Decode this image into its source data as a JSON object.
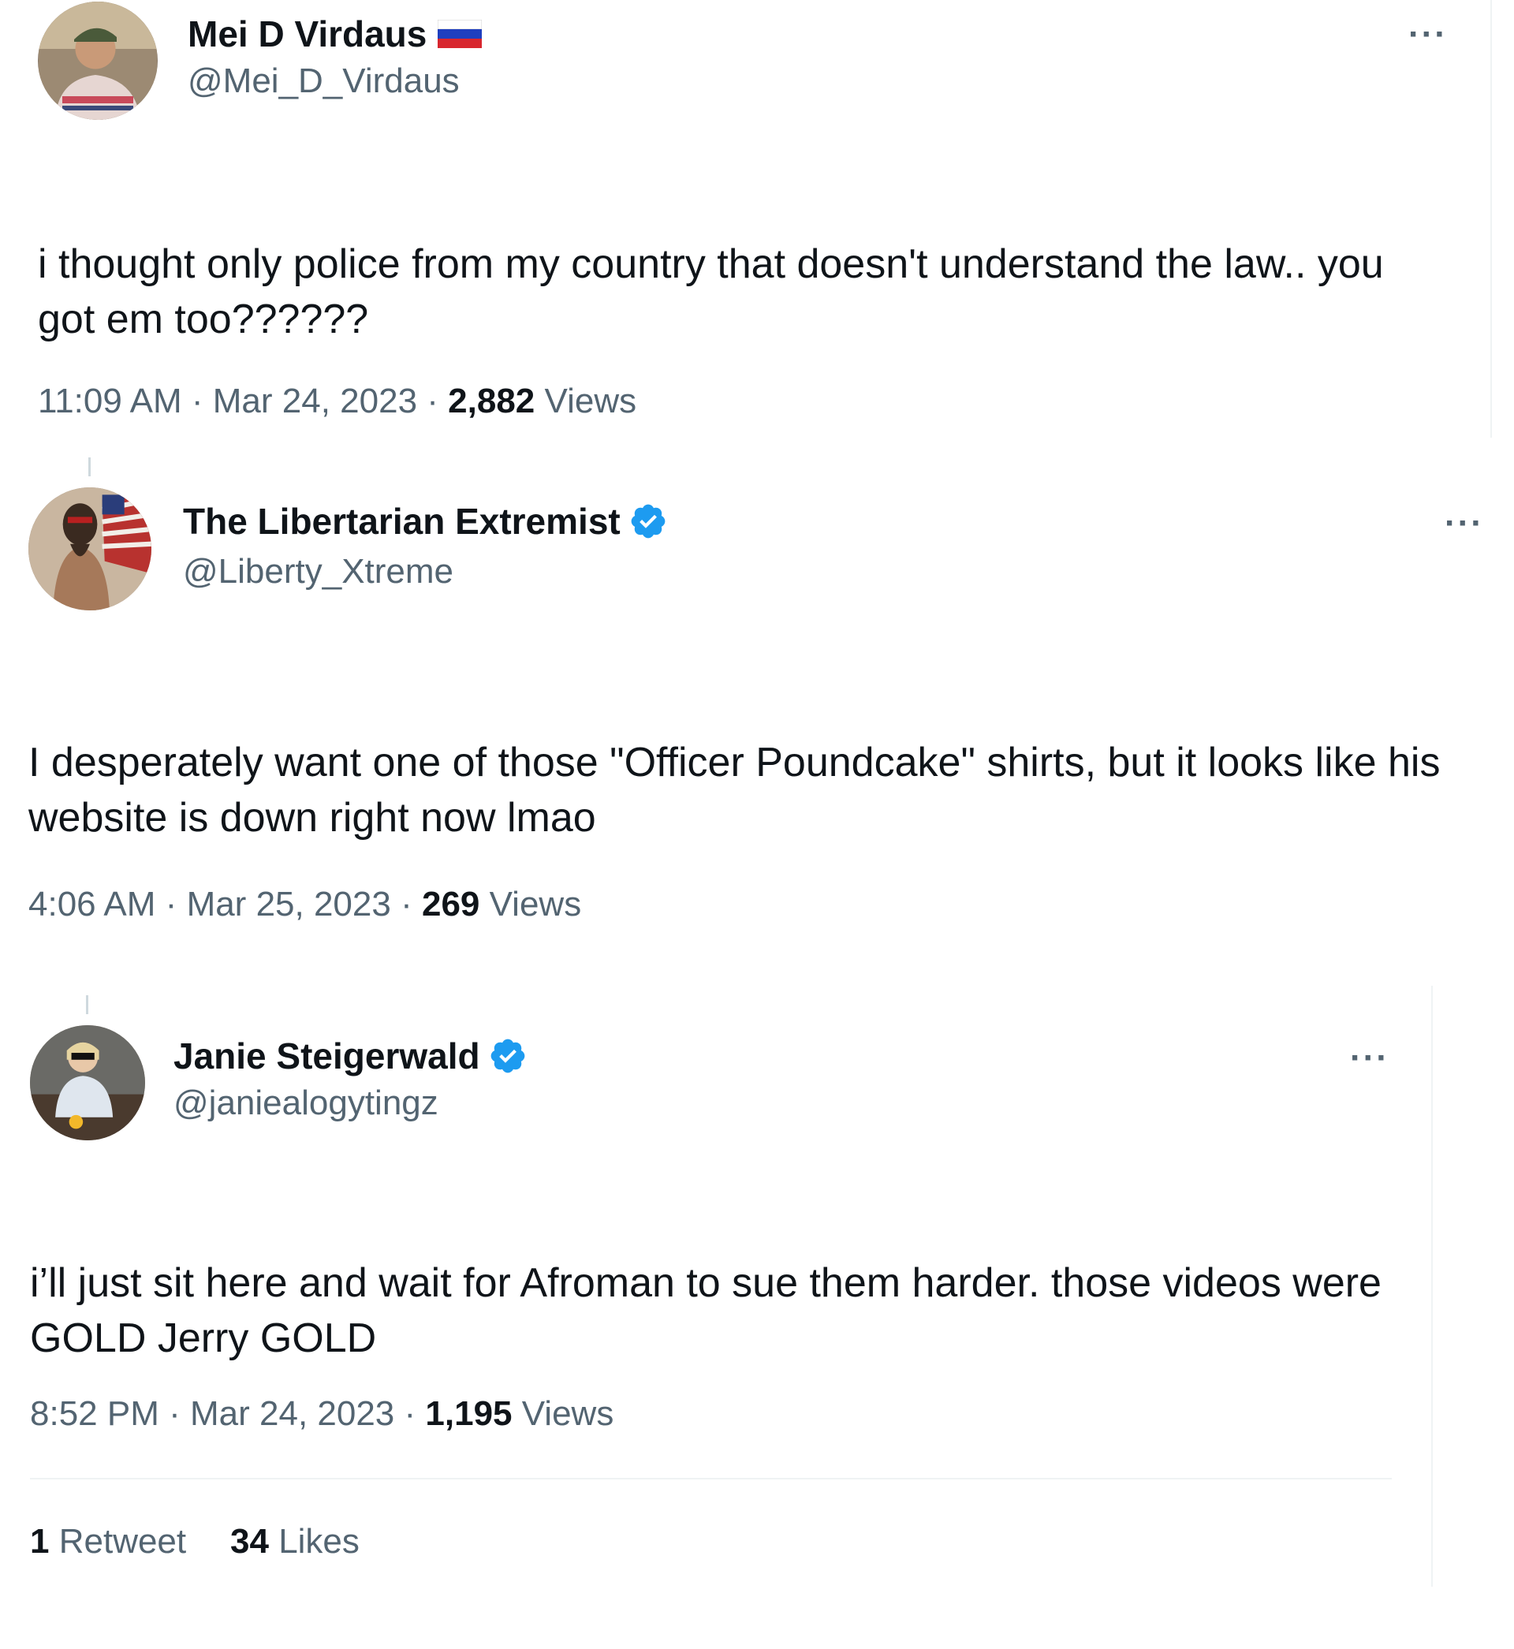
{
  "tweets": [
    {
      "name": "Mei D Virdaus",
      "handle": "@Mei_D_Virdaus",
      "flag_icon": "russia-flag-icon",
      "text": "i thought only police from my country that doesn't understand the law.. you got em too??????",
      "time": "11:09 AM",
      "date": "Mar 24, 2023",
      "views_count": "2,882",
      "views_label": "Views",
      "more": "···"
    },
    {
      "name": "The Libertarian Extremist",
      "handle": "@Liberty_Xtreme",
      "verified": true,
      "text": "I desperately want one of those \"Officer Poundcake\" shirts, but it looks like his website is down right now lmao",
      "time": "4:06 AM",
      "date": "Mar 25, 2023",
      "views_count": "269",
      "views_label": "Views",
      "more": "···"
    },
    {
      "name": "Janie Steigerwald",
      "handle": "@janiealogytingz",
      "verified": true,
      "text": "i’ll just sit here and wait for Afroman to sue them harder. those videos were GOLD Jerry GOLD",
      "time": "8:52 PM",
      "date": "Mar 24, 2023",
      "views_count": "1,195",
      "views_label": "Views",
      "more": "···",
      "retweets_count": "1",
      "retweets_label": "Retweet",
      "likes_count": "34",
      "likes_label": "Likes"
    }
  ],
  "separator": "·",
  "colors": {
    "text": "#0f1419",
    "secondary": "#536471",
    "verified": "#1d9bf0",
    "divider": "#eff3f4"
  }
}
